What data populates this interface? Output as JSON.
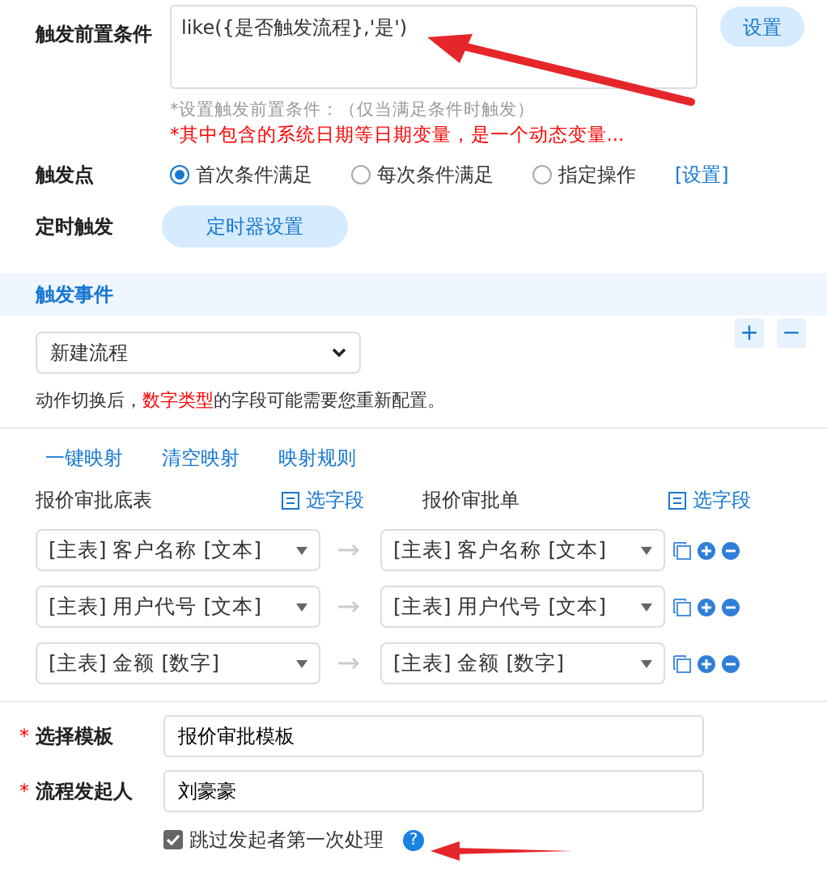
{
  "precondition": {
    "label": "触发前置条件",
    "value": "like({是否触发流程},'是')",
    "button": "设置",
    "hint": "*设置触发前置条件：（仅当满足条件时触发）",
    "warning": "*其中包含的系统日期等日期变量，是一个动态变量..."
  },
  "trigger_point": {
    "label": "触发点",
    "options": [
      {
        "label": "首次条件满足",
        "selected": true
      },
      {
        "label": "每次条件满足",
        "selected": false
      },
      {
        "label": "指定操作",
        "selected": false
      }
    ],
    "link": "[设置]"
  },
  "timer": {
    "label": "定时触发",
    "button": "定时器设置"
  },
  "event_section": {
    "title": "触发事件",
    "add": "+",
    "remove": "−",
    "action": "新建流程",
    "note": {
      "before": "动作切换后，",
      "highlight": "数字类型",
      "after": "的字段可能需要您重新配置。"
    }
  },
  "mapping": {
    "actions": [
      "一键映射",
      "清空映射",
      "映射规则"
    ],
    "source": {
      "title": "报价审批底表",
      "pick": "选字段"
    },
    "target": {
      "title": "报价审批单",
      "pick": "选字段"
    },
    "rows": [
      {
        "source": "[主表] 客户名称 [文本]",
        "target": "[主表] 客户名称 [文本]"
      },
      {
        "source": "[主表] 用户代号 [文本]",
        "target": "[主表] 用户代号 [文本]"
      },
      {
        "source": "[主表] 金额 [数字]",
        "target": "[主表] 金额 [数字]"
      }
    ]
  },
  "form": {
    "fields": [
      {
        "required_mark": "*",
        "label": "选择模板",
        "value": "报价审批模板"
      },
      {
        "required_mark": "*",
        "label": "流程发起人",
        "value": "刘豪豪"
      }
    ],
    "skip": {
      "label": "跳过发起者第一次处理",
      "checked": true,
      "help": "?"
    }
  }
}
